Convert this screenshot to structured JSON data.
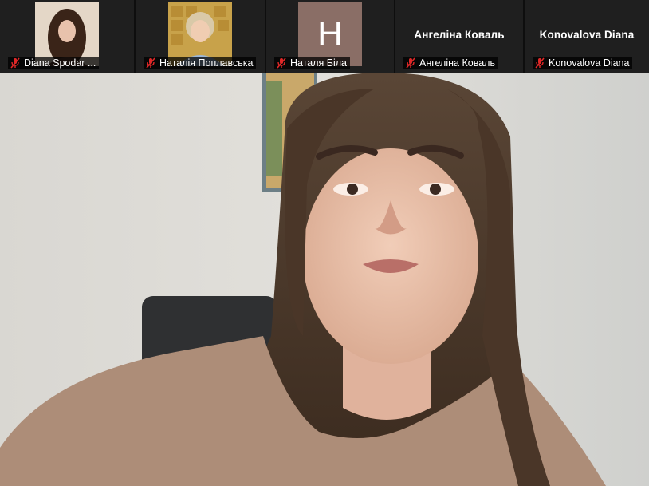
{
  "participants": [
    {
      "label": "Diana Spodar ...",
      "display": "photo",
      "muted": true
    },
    {
      "label": "Наталія Поплавська",
      "display": "photo",
      "muted": true
    },
    {
      "label": "Наталя Біла",
      "display": "initial",
      "initial": "Н",
      "avatar_color": "#8a6e66",
      "muted": true
    },
    {
      "label": "Ангеліна Коваль",
      "display": "name",
      "big_name": "Ангеліна Коваль",
      "muted": true
    },
    {
      "label": "Konovalova Diana",
      "display": "name",
      "big_name": "Konovalova Diana",
      "muted": true
    }
  ],
  "colors": {
    "mute_icon": "#e02828",
    "strip_bg": "#1a1a1a"
  }
}
